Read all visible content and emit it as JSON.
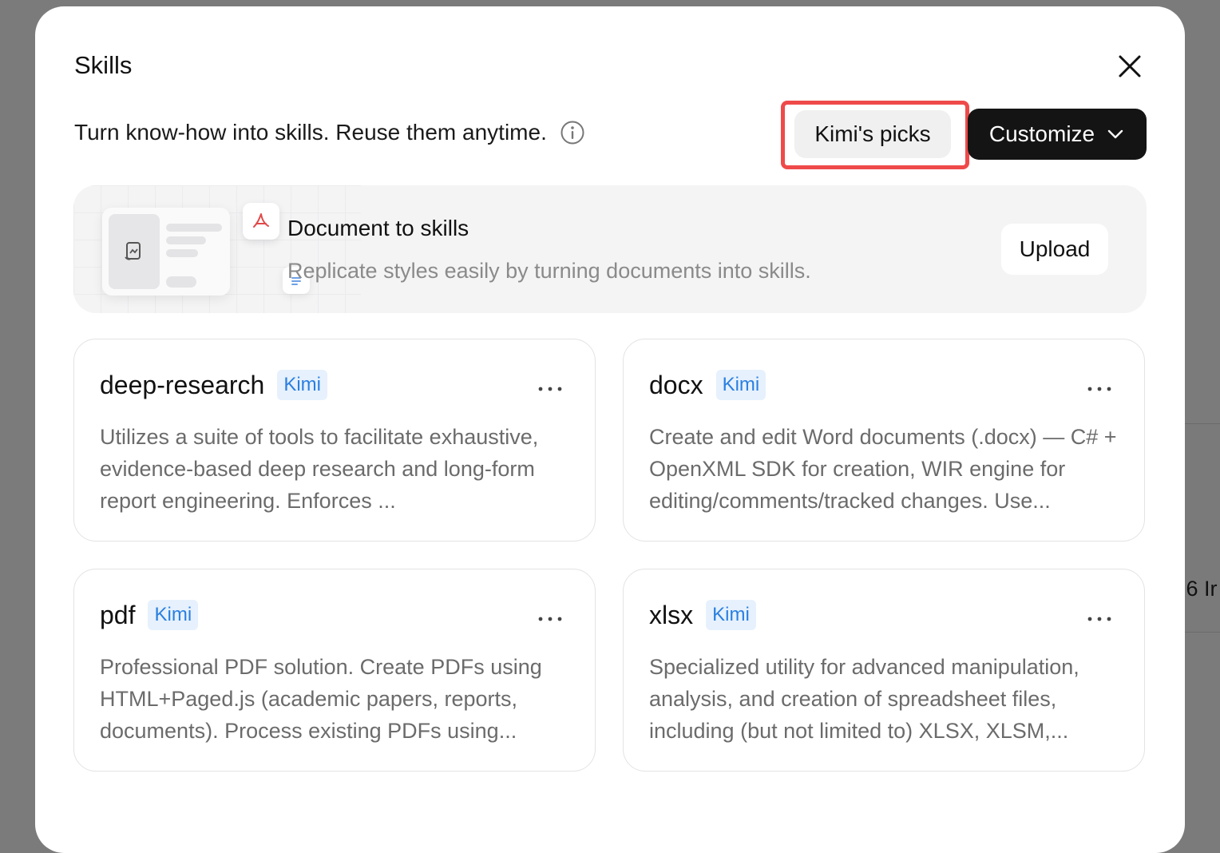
{
  "background": {
    "partial_text": ".6 Ir"
  },
  "modal": {
    "title": "Skills",
    "subtitle": "Turn know-how into skills. Reuse them anytime.",
    "picks_label": "Kimi's picks",
    "customize_label": "Customize"
  },
  "banner": {
    "title": "Document to skills",
    "description": "Replicate styles easily by turning documents into skills.",
    "upload_label": "Upload"
  },
  "skills": [
    {
      "name": "deep-research",
      "tag": "Kimi",
      "description": "Utilizes a suite of tools to facilitate exhaustive, evidence-based deep research and long-form report engineering. Enforces ..."
    },
    {
      "name": "docx",
      "tag": "Kimi",
      "description": "Create and edit Word documents (.docx) — C# + OpenXML SDK for creation, WIR engine for editing/comments/tracked changes. Use..."
    },
    {
      "name": "pdf",
      "tag": "Kimi",
      "description": "Professional PDF solution. Create PDFs using HTML+Paged.js (academic papers, reports, documents). Process existing PDFs using..."
    },
    {
      "name": "xlsx",
      "tag": "Kimi",
      "description": "Specialized utility for advanced manipulation, analysis, and creation of spreadsheet files, including (but not limited to) XLSX, XLSM,..."
    }
  ],
  "colors": {
    "overlay": "#7b7b7b",
    "accent_tag_bg": "#e6f1fd",
    "accent_tag_text": "#2a7fe0",
    "highlight_border": "#ef4a4a",
    "primary_button": "#141414"
  },
  "icons": {
    "close": "close-icon",
    "info": "info-icon",
    "chevron": "chevron-down-icon",
    "more": "more-icon",
    "pdf": "pdf-icon",
    "document": "document-icon"
  }
}
